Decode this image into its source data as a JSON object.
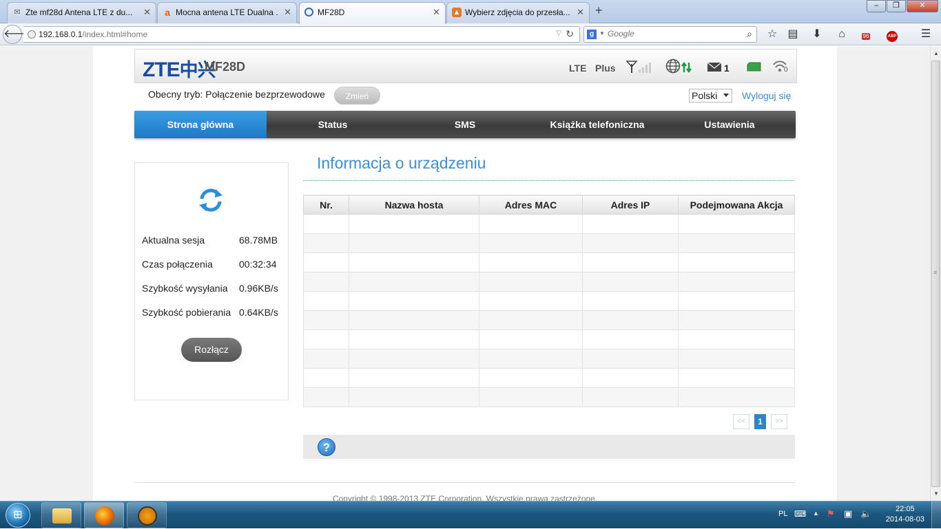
{
  "browser": {
    "tabs": [
      {
        "title": "Zte mf28d Antena LTE z du...",
        "active": false
      },
      {
        "title": "Mocna antena LTE Dualna ...",
        "active": false
      },
      {
        "title": "MF28D",
        "active": true
      },
      {
        "title": "Wybierz zdjęcia do przesła...",
        "active": false
      }
    ],
    "url_host": "192.168.0.1",
    "url_path": "/index.html#home",
    "search_placeholder": "Google",
    "downloads_badge": "96",
    "abp_label": "ABP"
  },
  "router": {
    "brand": "ZTE",
    "brand_cn": "中兴",
    "model": "MF28D",
    "status": {
      "network_type": "LTE",
      "operator": "Plus",
      "sms_count": "1",
      "wifi_clients": "0"
    },
    "mode_label": "Obecny tryb: Połączenie bezprzewodowe",
    "change_button": "Zmień",
    "language": "Polski",
    "logout": "Wyloguj się",
    "nav": [
      "Strona główna",
      "Status",
      "SMS",
      "Książka telefoniczna",
      "Ustawienia"
    ],
    "stats": [
      {
        "label": "Aktualna sesja",
        "value": "68.78MB"
      },
      {
        "label": "Czas połączenia",
        "value": "00:32:34"
      },
      {
        "label": "Szybkość wysyłania",
        "value": "0.96KB/s"
      },
      {
        "label": "Szybkość pobierania",
        "value": "0.64KB/s"
      }
    ],
    "disconnect_button": "Rozłącz",
    "device_section_title": "Informacja o urządzeniu",
    "table_headers": [
      "Nr.",
      "Nazwa hosta",
      "Adres MAC",
      "Adres IP",
      "Podejmowana Akcja"
    ],
    "pager": {
      "prev": "<<",
      "current": "1",
      "next": ">>"
    },
    "help": "?",
    "copyright": "Copyright © 1998-2013 ZTE Corporation. Wszystkie prawa zastrzeżone."
  },
  "taskbar": {
    "language": "PL",
    "time": "22:05",
    "date": "2014-08-03"
  },
  "colors": {
    "accent_blue": "#1d79c6",
    "link_blue": "#3b8fd6",
    "nav_dark": "#3a3a3a",
    "signal_green": "#1a9b3a"
  }
}
